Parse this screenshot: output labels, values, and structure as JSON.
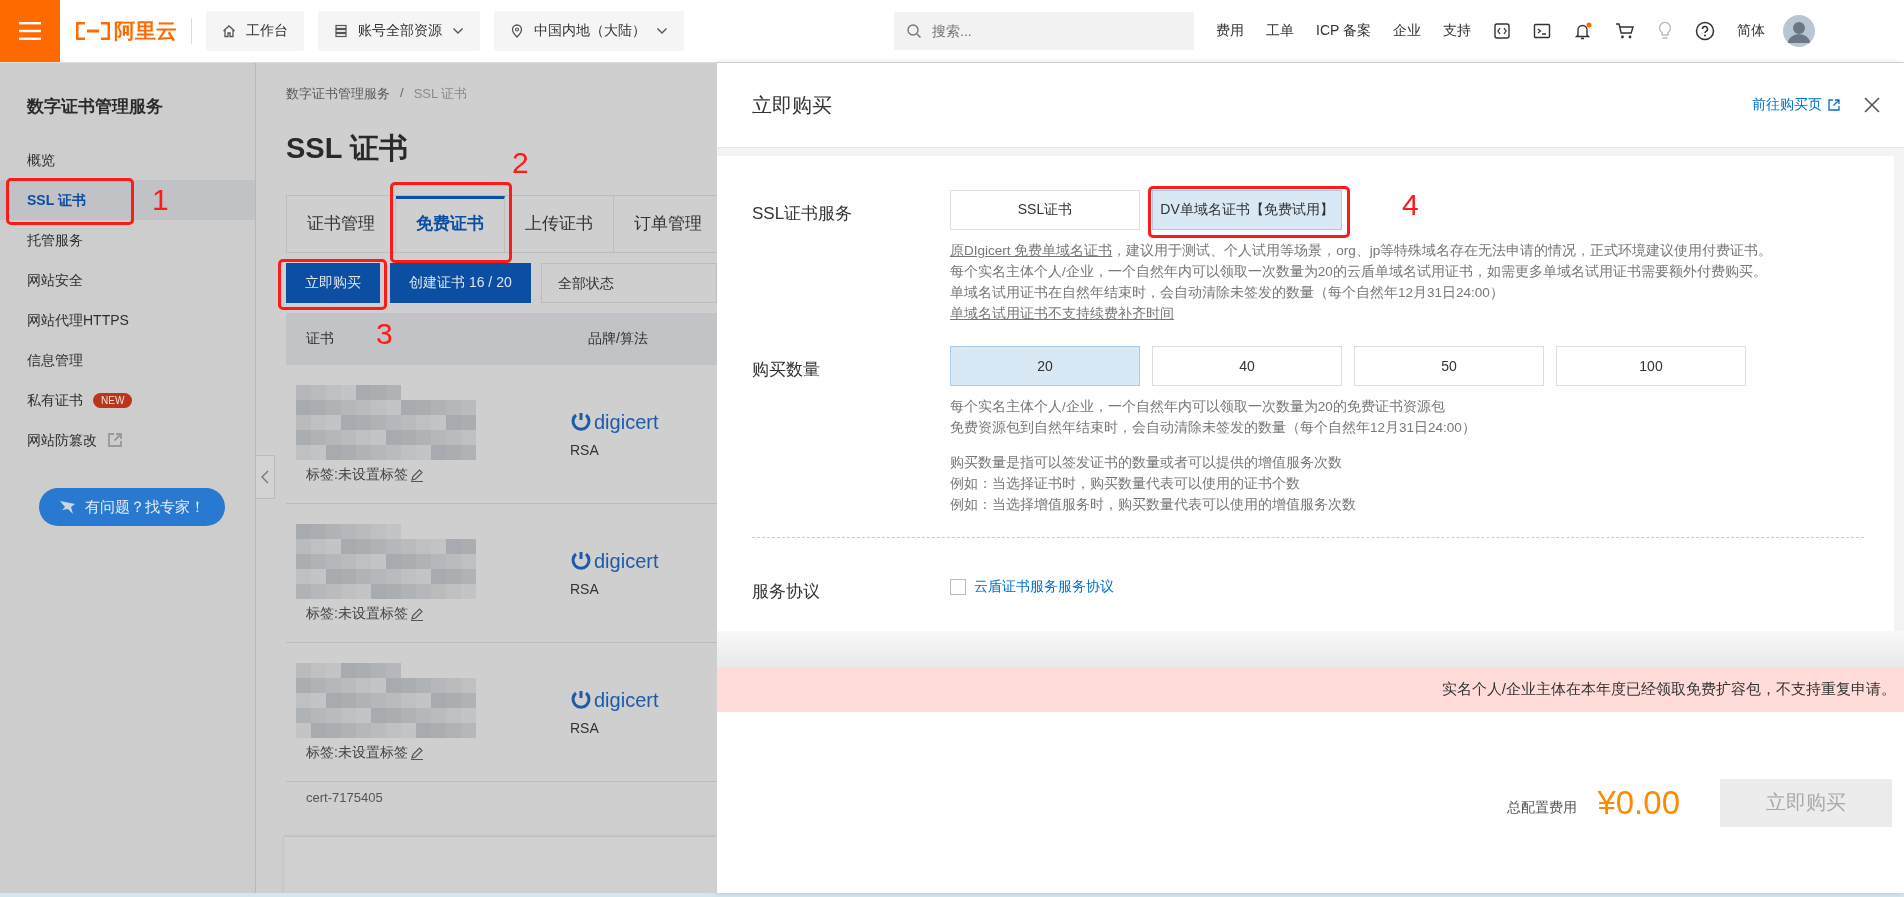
{
  "topbar": {
    "logo": "阿里云",
    "nav_buttons": [
      {
        "kind": "home",
        "label": "工作台"
      },
      {
        "kind": "resources",
        "label": "账号全部资源"
      },
      {
        "kind": "region",
        "label": "中国内地（大陆）"
      }
    ],
    "search": {
      "placeholder": "搜索..."
    },
    "links": [
      "费用",
      "工单",
      "ICP 备案",
      "企业",
      "支持"
    ],
    "language": "简体"
  },
  "sidebar": {
    "title": "数字证书管理服务",
    "items": [
      {
        "label": "概览",
        "selected": false
      },
      {
        "label": "SSL 证书",
        "selected": true,
        "callout": "1"
      },
      {
        "label": "托管服务",
        "selected": false
      },
      {
        "label": "网站安全",
        "selected": false
      },
      {
        "label": "网站代理HTTPS",
        "selected": false
      },
      {
        "label": "信息管理",
        "selected": false
      },
      {
        "label": "私有证书",
        "selected": false,
        "badge": "NEW"
      },
      {
        "label": "网站防篡改",
        "selected": false,
        "external": true
      }
    ],
    "help_button": "有问题？找专家！"
  },
  "main": {
    "breadcrumb": [
      "数字证书管理服务",
      "SSL 证书"
    ],
    "breadcrumb_separator": "/",
    "title": "SSL 证书",
    "tabs": [
      {
        "label": "证书管理",
        "selected": false
      },
      {
        "label": "免费证书",
        "selected": true,
        "callout": "2"
      },
      {
        "label": "上传证书",
        "selected": false
      },
      {
        "label": "订单管理",
        "selected": false
      }
    ],
    "buy_button": {
      "label": "立即购买",
      "callout": "3"
    },
    "create_button": "创建证书 16 / 20",
    "status_filter": "全部状态",
    "table": {
      "columns": [
        "证书",
        "品牌/算法"
      ],
      "rows": [
        {
          "tag": "标签:未设置标签",
          "brand": "digicert",
          "algorithm": "RSA"
        },
        {
          "tag": "标签:未设置标签",
          "brand": "digicert",
          "algorithm": "RSA"
        },
        {
          "tag": "标签:未设置标签",
          "brand": "digicert",
          "algorithm": "RSA"
        }
      ],
      "partial_row": "cert-7175405"
    }
  },
  "drawer": {
    "title": "立即购买",
    "purchase_link": "前往购买页",
    "service": {
      "label": "SSL证书服务",
      "options": [
        {
          "label": "SSL证书",
          "selected": false
        },
        {
          "label": "DV单域名证书【免费试用】",
          "selected": true,
          "callout": "4"
        }
      ],
      "notes": [
        {
          "link": "原DIgicert 免费单域名证书",
          "text": "，建议用于测试、个人试用等场景，org、jp等特殊域名存在无法申请的情况，正式环境建议使用付费证书。"
        },
        {
          "text": "每个实名主体个人/企业，一个自然年内可以领取一次数量为20的云盾单域名试用证书，如需更多单域名试用证书需要额外付费购买。"
        },
        {
          "text": "单域名试用证书在自然年结束时，会自动清除未签发的数量（每个自然年12月31日24:00）"
        },
        {
          "link": "单域名试用证书不支持续费补齐时间"
        }
      ]
    },
    "quantity": {
      "label": "购买数量",
      "options": [
        {
          "label": "20",
          "selected": true
        },
        {
          "label": "40",
          "selected": false
        },
        {
          "label": "50",
          "selected": false
        },
        {
          "label": "100",
          "selected": false
        }
      ],
      "notes": [
        [
          "每个实名主体个人/企业，一个自然年内可以领取一次数量为20的免费证书资源包",
          "免费资源包到自然年结束时，会自动清除未签发的数量（每个自然年12月31日24:00）"
        ],
        [
          "购买数量是指可以签发证书的数量或者可以提供的增值服务次数",
          "例如：当选择证书时，购买数量代表可以使用的证书个数",
          "例如：当选择增值服务时，购买数量代表可以使用的增值服务次数"
        ]
      ]
    },
    "agreement": {
      "label": "服务协议",
      "checked": false,
      "link": "云盾证书服务服务协议"
    },
    "warning": "实名个人/企业主体在本年度已经领取免费扩容包，不支持重复申请。",
    "footer": {
      "cost_label": "总配置费用",
      "price": "¥0.00",
      "buy_button": {
        "label": "立即购买",
        "disabled": true
      }
    }
  }
}
